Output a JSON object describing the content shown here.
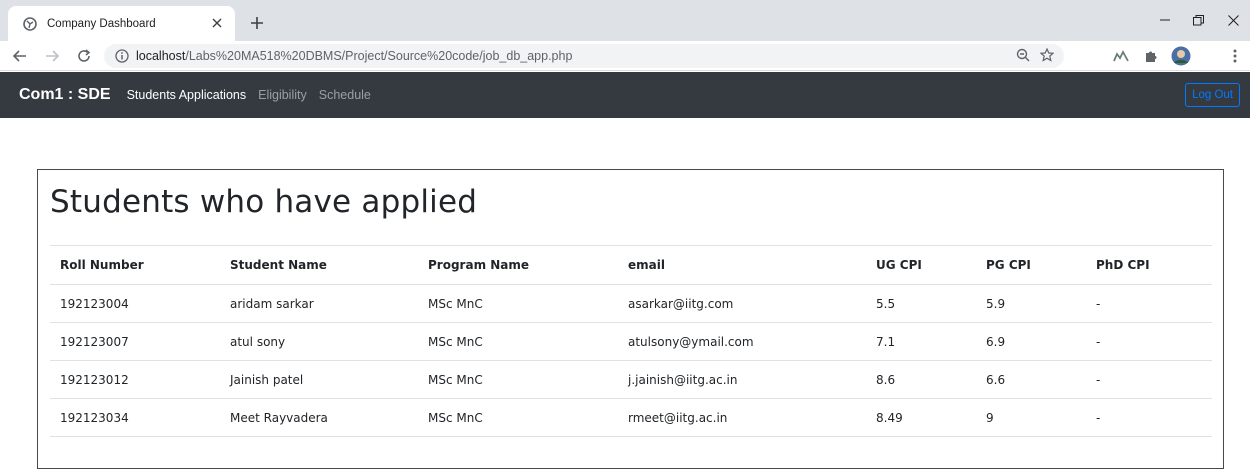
{
  "browser": {
    "tab_title": "Company Dashboard",
    "url_host": "localhost",
    "url_path": "/Labs%20MA518%20DBMS/Project/Source%20code/job_db_app.php"
  },
  "navbar": {
    "brand": "Com1 : SDE",
    "links": [
      {
        "label": "Students Applications",
        "active": true
      },
      {
        "label": "Eligibility",
        "active": false
      },
      {
        "label": "Schedule",
        "active": false
      }
    ],
    "logout_label": "Log Out"
  },
  "main": {
    "title": "Students who have applied",
    "table": {
      "columns": [
        "Roll Number",
        "Student Name",
        "Program Name",
        "email",
        "UG CPI",
        "PG CPI",
        "PhD CPI"
      ],
      "rows": [
        [
          "192123004",
          "aridam sarkar",
          "MSc MnC",
          "asarkar@iitg.com",
          "5.5",
          "5.9",
          "-"
        ],
        [
          "192123007",
          "atul sony",
          "MSc MnC",
          "atulsony@ymail.com",
          "7.1",
          "6.9",
          "-"
        ],
        [
          "192123012",
          "Jainish patel",
          "MSc MnC",
          "j.jainish@iitg.ac.in",
          "8.6",
          "6.6",
          "-"
        ],
        [
          "192123034",
          "Meet Rayvadera",
          "MSc MnC",
          "rmeet@iitg.ac.in",
          "8.49",
          "9",
          "-"
        ]
      ]
    }
  },
  "colors": {
    "navbar_bg": "#343a40",
    "logout_border": "#007bff"
  }
}
